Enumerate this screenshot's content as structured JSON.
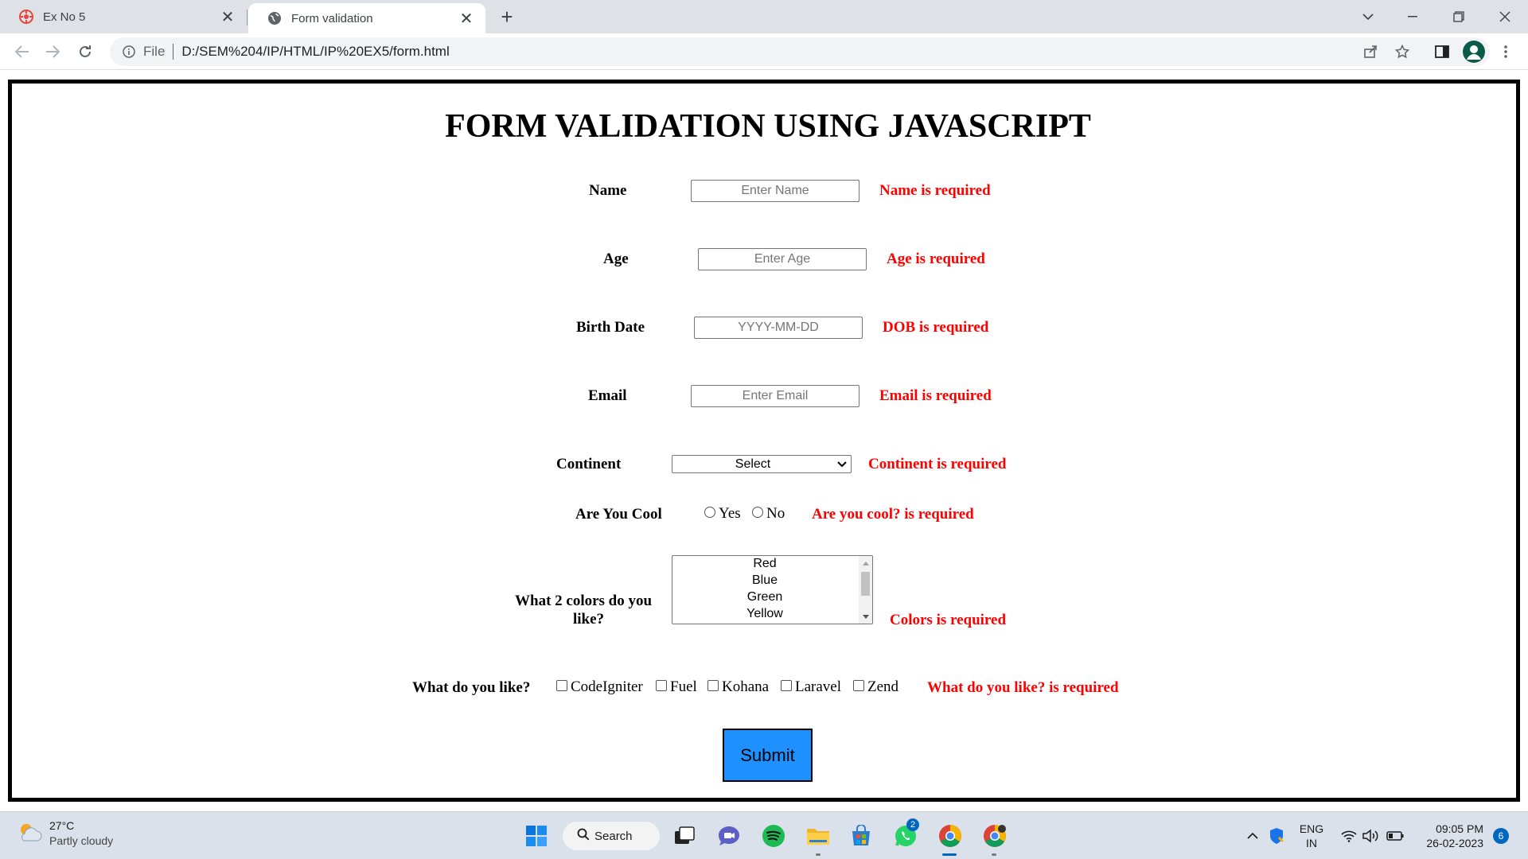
{
  "browser": {
    "tabs": [
      {
        "title": "Ex No 5",
        "icon": "dashboard-icon",
        "active": false
      },
      {
        "title": "Form validation",
        "icon": "globe-icon",
        "active": true
      }
    ],
    "address": {
      "scheme": "File",
      "url": "D:/SEM%204/IP/HTML/IP%20EX5/form.html"
    }
  },
  "page": {
    "title": "FORM VALIDATION USING JAVASCRIPT",
    "fields": {
      "name": {
        "label": "Name",
        "placeholder": "Enter Name",
        "error": "Name is required"
      },
      "age": {
        "label": "Age",
        "placeholder": "Enter Age",
        "error": "Age is required"
      },
      "dob": {
        "label": "Birth Date",
        "placeholder": "YYYY-MM-DD",
        "error": "DOB is required"
      },
      "email": {
        "label": "Email",
        "placeholder": "Enter Email",
        "error": "Email is required"
      },
      "continent": {
        "label": "Continent",
        "selected": "Select",
        "error": "Continent is required"
      },
      "cool": {
        "label": "Are You Cool",
        "options": [
          "Yes",
          "No"
        ],
        "error": "Are you cool? is required"
      },
      "colors": {
        "label_line1": "What 2 colors do you",
        "label_line2": "like?",
        "options": [
          "Red",
          "Blue",
          "Green",
          "Yellow"
        ],
        "error": "Colors is required"
      },
      "frameworks": {
        "label": "What do you like?",
        "options": [
          "CodeIgniter",
          "Fuel",
          "Kohana",
          "Laravel",
          "Zend"
        ],
        "error": "What do you like? is required"
      }
    },
    "submit_label": "Submit"
  },
  "taskbar": {
    "weather": {
      "temp": "27°C",
      "condition": "Partly cloudy"
    },
    "search_label": "Search",
    "badges": {
      "whatsapp": "2",
      "notifications": "6"
    },
    "lang": {
      "line1": "ENG",
      "line2": "IN"
    },
    "clock": {
      "time": "09:05 PM",
      "date": "26-02-2023"
    }
  },
  "colors": {
    "error": "#ff0000",
    "submit": "#1e90ff",
    "accent": "#0067c0"
  }
}
